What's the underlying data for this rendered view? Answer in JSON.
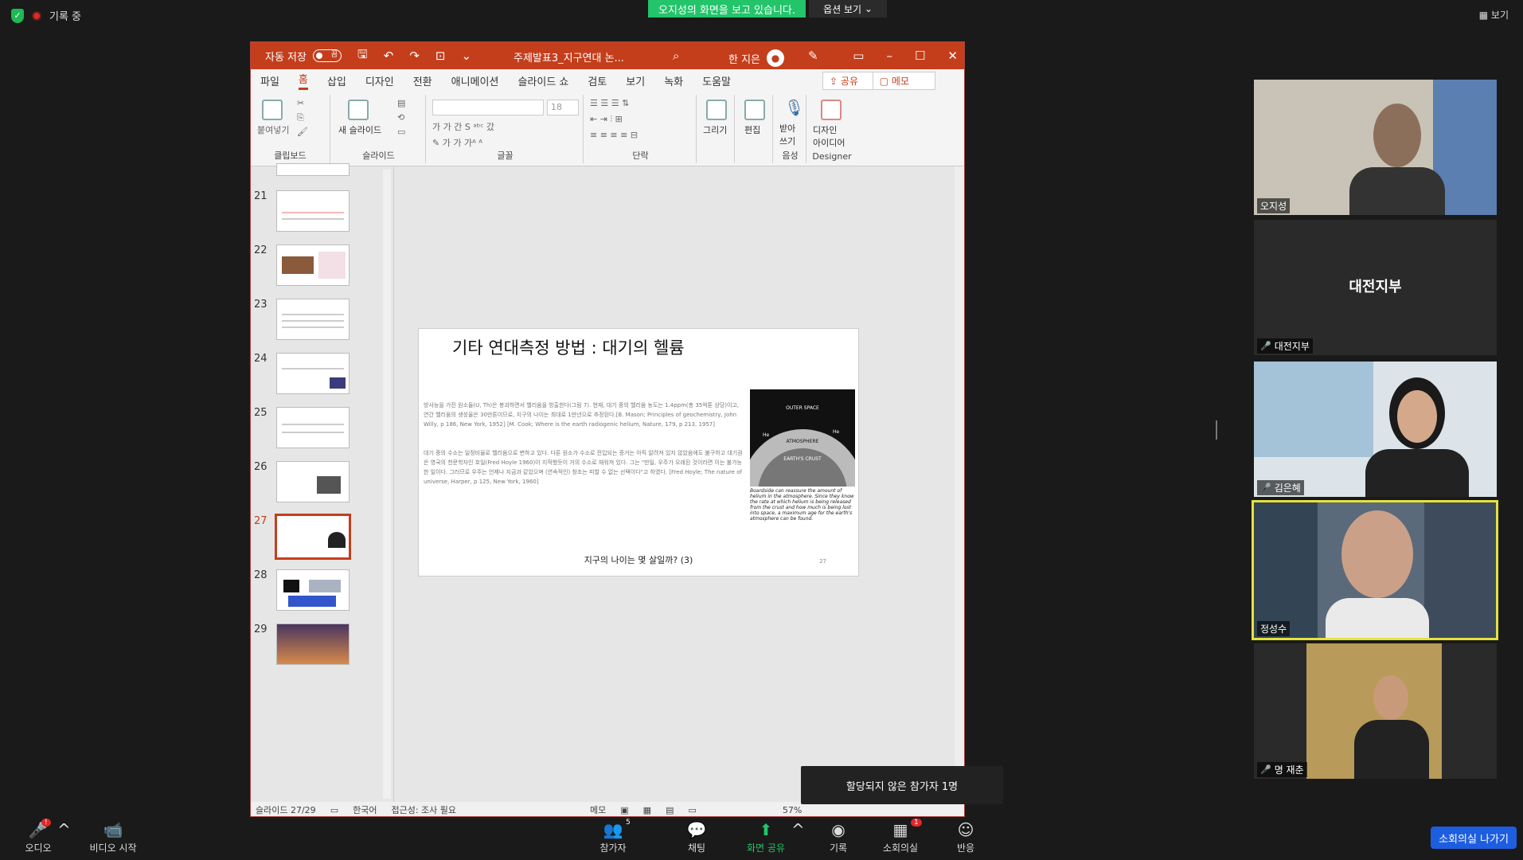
{
  "zoom": {
    "recording_label": "기록 중",
    "share_banner": "오지성의 화면을 보고 있습니다.",
    "view_options": "옵션 보기",
    "view_toggle": "보기",
    "tooltip": "할당되지 않은 참가자 1명",
    "leave_button": "소회의실 나가기",
    "toolbar": {
      "audio": "오디오",
      "video": "비디오 시작",
      "participants": "참가자",
      "participants_count": "5",
      "chat": "채팅",
      "share": "화면 공유",
      "record": "기록",
      "breakout": "소회의실",
      "breakout_badge": "1",
      "reactions": "반응"
    },
    "participants": [
      {
        "name": "오지성",
        "muted": false
      },
      {
        "name": "대전지부",
        "muted": true,
        "display": "대전지부"
      },
      {
        "name": "김은혜",
        "muted": true
      },
      {
        "name": "정성수",
        "muted": false
      },
      {
        "name": "명 재춘",
        "muted": true
      }
    ]
  },
  "ppt": {
    "autosave_label": "자동 저장",
    "autosave_state": "끔",
    "doc_title": "주제발표3_지구연대 논...",
    "user_name": "한 지은",
    "tabs": [
      "파일",
      "홈",
      "삽입",
      "디자인",
      "전환",
      "애니메이션",
      "슬라이드 쇼",
      "검토",
      "보기",
      "녹화",
      "도움말"
    ],
    "share_button": "공유",
    "memo_button": "메모",
    "ribbon": {
      "clipboard": "클립보드",
      "paste": "붙여넣기",
      "slides": "슬라이드",
      "new_slide": "새 슬라이드",
      "font": "글꼴",
      "font_size": "18",
      "paragraph": "단락",
      "draw": "그리기",
      "edit": "편집",
      "dictate": "받아\n쓰기",
      "voice": "음성",
      "designer_idea": "디자인\n아이디어",
      "designer": "Designer"
    },
    "thumbnails": [
      "21",
      "22",
      "23",
      "24",
      "25",
      "26",
      "27",
      "28",
      "29"
    ],
    "selected_thumbnail": "27",
    "slide": {
      "title": "기타 연대측정 방법 : 대기의 헬륨",
      "para1": "방사능을 가진 원소들(U, Th)은 붕괴하면서 헬리움을 방출한다(그림 7). 현재, 대기 중의 헬리움 농도는 1.4ppm(총 35억톤 상당)이고, 연간 헬리움의 생성율은 30만톤이므로, 지구의 나이는 최대로 1만년으로 추정된다.[B. Mason; Principles of geochemistry, John Willy, p 186, New York, 1952] [M. Cook; Where is the earth radiogenic helium, Nature, 179, p 213, 1957]",
      "para2": "대기 중의 수소는 일정비율로 헬리움으로 변하고 있다. 다른 원소가 수소로 전입되는 증거는 아직 알려져 있지 않았음에도 불구하고 대기권은 영국의 천문학자인 호일(Fred Hoyle 1960)이 지적했듯이 거의 수소로 채워져 있다. 그는 \"만일, 우주가 오래된 것이라면 이는 불가능한 일이다. 그러므로 우주는 언제나 지금과 같았으며 (연속적인) 창조는 피할 수 없는 선택이다\"고 하였다. [Fred Hoyle; The nature of universe, Harper, p 125, New York, 1960]",
      "figure_labels": {
        "outer_space": "OUTER SPACE",
        "atmosphere": "ATMOSPHERE",
        "crust": "EARTH'S CRUST",
        "he": "He"
      },
      "figure_caption": "Boardside can reassure the amount of helium in the atmosphere. Since they know the rate at which helium is being released from the crust and how much is being lost into space, a maximum age for the earth's atmosphere can be found.",
      "footer": "지구의 나이는 몇 살일까? (3)",
      "number": "27"
    },
    "status": {
      "slide_of": "슬라이드 27/29",
      "language": "한국어",
      "accessibility": "접근성: 조사 필요",
      "notes": "메모",
      "zoom": "57%"
    }
  }
}
